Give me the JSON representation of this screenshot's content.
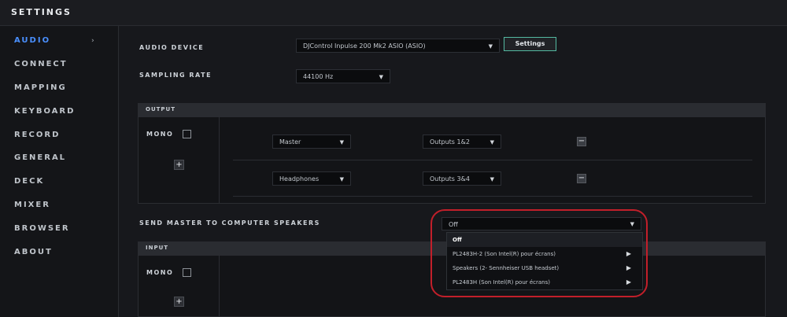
{
  "window": {
    "title": "SETTINGS"
  },
  "sidebar": {
    "items": [
      {
        "label": "AUDIO",
        "active": true,
        "chevron": "›"
      },
      {
        "label": "CONNECT"
      },
      {
        "label": "MAPPING"
      },
      {
        "label": "KEYBOARD"
      },
      {
        "label": "RECORD"
      },
      {
        "label": "GENERAL"
      },
      {
        "label": "DECK"
      },
      {
        "label": "MIXER"
      },
      {
        "label": "BROWSER"
      },
      {
        "label": "ABOUT"
      }
    ]
  },
  "audio": {
    "device_label": "AUDIO DEVICE",
    "device_value": "DJControl Inpulse 200 Mk2 ASIO (ASIO)",
    "settings_button": "Settings",
    "sampling_label": "SAMPLING RATE",
    "sampling_value": "44100 Hz"
  },
  "output": {
    "title": "OUTPUT",
    "mono_label": "MONO",
    "plus": "+",
    "rows": [
      {
        "channel": "Master",
        "outputs": "Outputs 1&2",
        "remove": "−"
      },
      {
        "channel": "Headphones",
        "outputs": "Outputs 3&4",
        "remove": "−"
      }
    ]
  },
  "send_master": {
    "label": "SEND MASTER TO COMPUTER SPEAKERS",
    "value": "Off",
    "options": [
      {
        "label": "Off",
        "selected": true
      },
      {
        "label": "PL2483H-2 (Son Intel(R) pour écrans)",
        "arrow": "▶"
      },
      {
        "label": "Speakers (2- Sennheiser USB headset)",
        "arrow": "▶"
      },
      {
        "label": "PL2483H (Son Intel(R) pour écrans)",
        "arrow": "▶"
      }
    ]
  },
  "input": {
    "title": "INPUT",
    "mono_label": "MONO",
    "plus": "+"
  },
  "icons": {
    "dropdown_arrow": "▼"
  },
  "colors": {
    "accent_blue": "#4a90ff",
    "settings_button_border": "#54b9a1",
    "highlight_red": "#c21f2a"
  }
}
